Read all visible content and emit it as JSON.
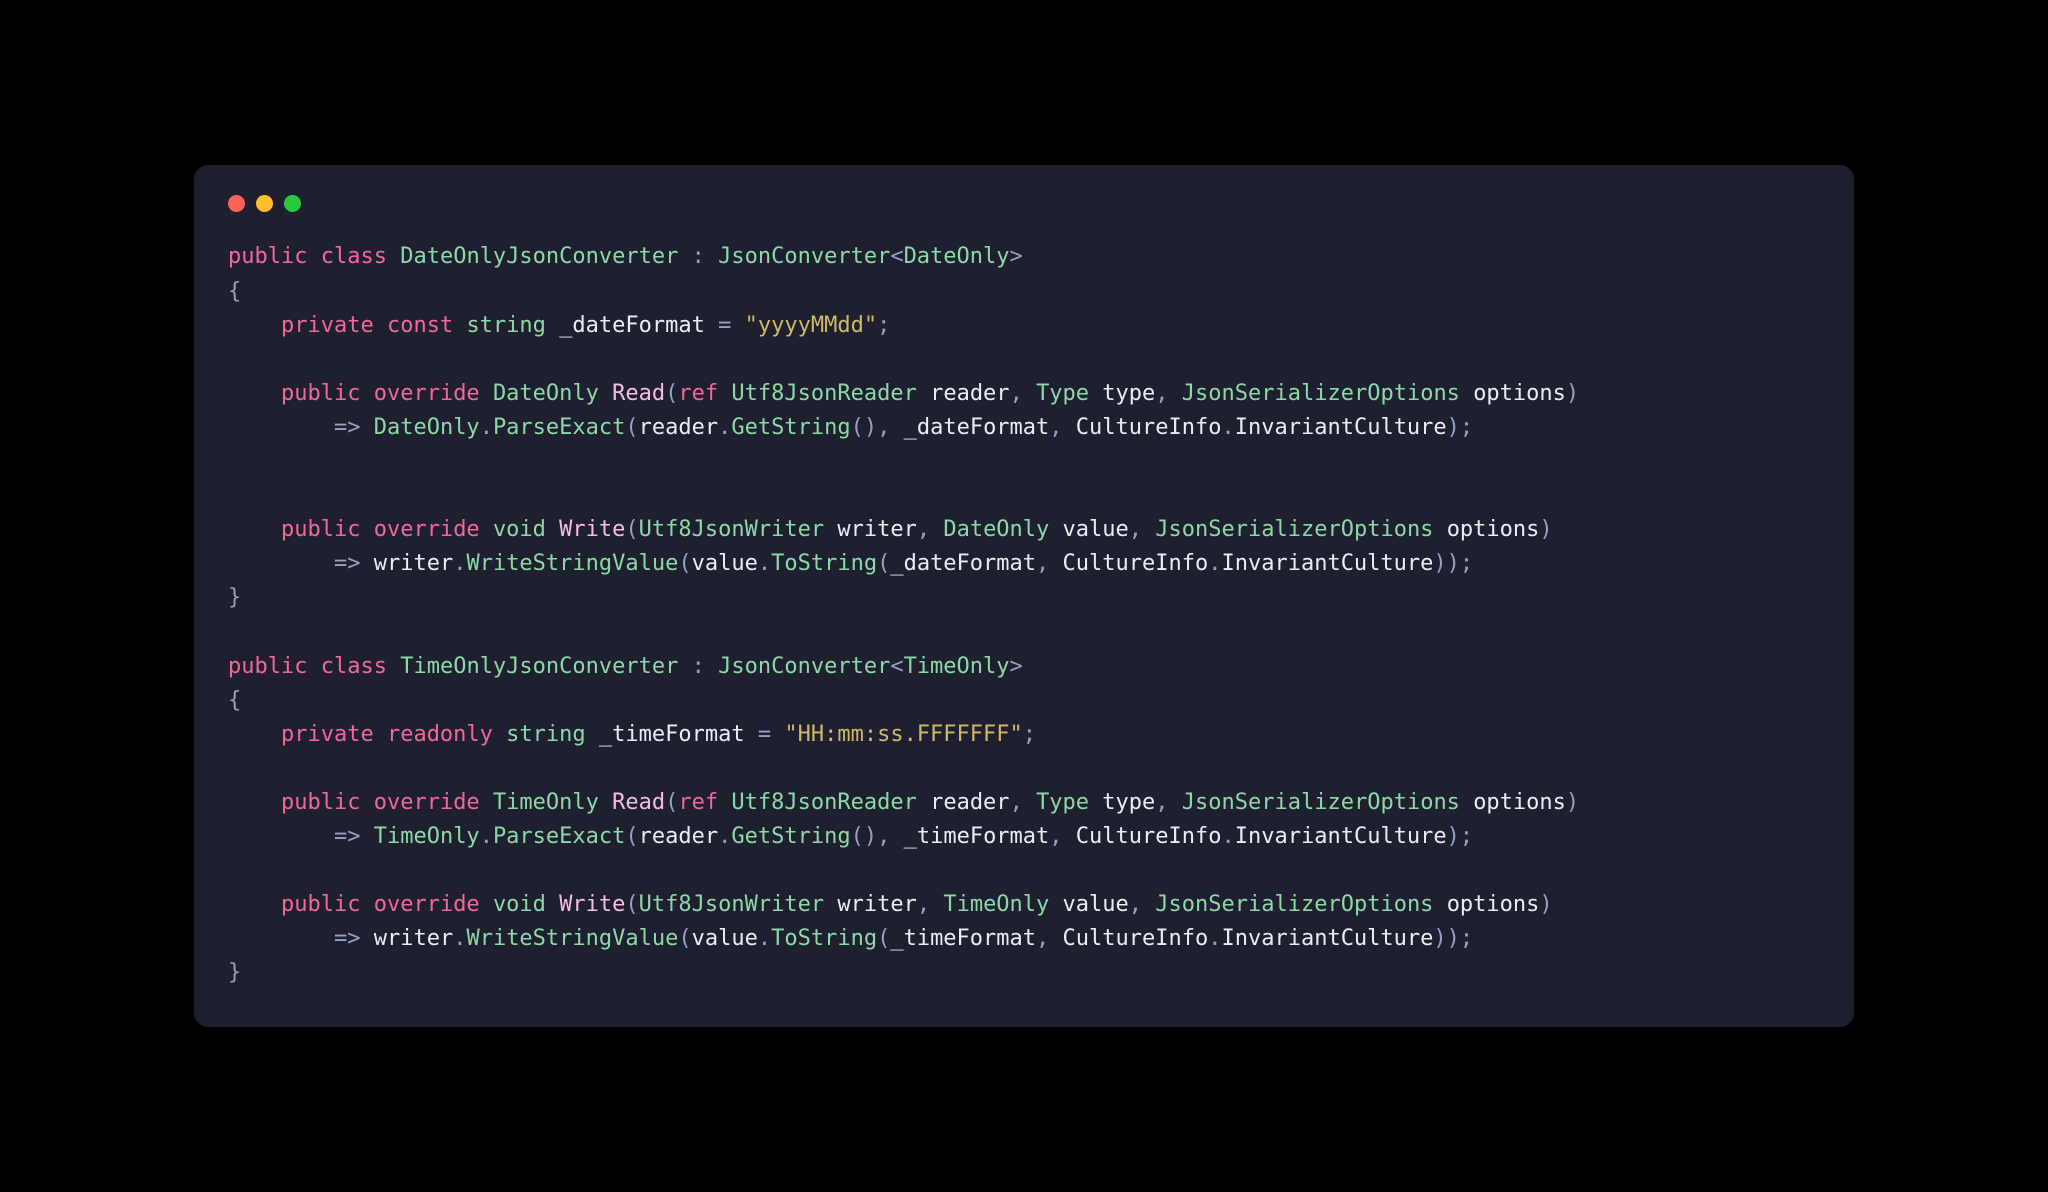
{
  "code": {
    "line1": {
      "kw_public": "public",
      "kw_class": "class",
      "ty_name": "DateOnlyJsonConverter",
      "colon": ":",
      "ty_base": "JsonConverter",
      "lt": "<",
      "ty_param": "DateOnly",
      "gt": ">"
    },
    "line2": {
      "brace": "{"
    },
    "line3": {
      "kw_private": "private",
      "kw_const": "const",
      "ty_string": "string",
      "id_field": "_dateFormat",
      "eq": "=",
      "str": "\"yyyyMMdd\"",
      "semi": ";"
    },
    "line4": "",
    "line5": {
      "kw_public": "public",
      "kw_override": "override",
      "ty_ret": "DateOnly",
      "fn_name": "Read",
      "lp": "(",
      "kw_ref": "ref",
      "ty_p1": "Utf8JsonReader",
      "id_p1": "reader",
      "c1": ",",
      "ty_p2": "Type",
      "id_p2": "type",
      "c2": ",",
      "ty_p3": "JsonSerializerOptions",
      "id_p3": "options",
      "rp": ")"
    },
    "line6": {
      "arrow": "=>",
      "ty": "DateOnly",
      "dot1": ".",
      "mth1": "ParseExact",
      "lp": "(",
      "id_r": "reader",
      "dot2": ".",
      "mth2": "GetString",
      "lp2": "(",
      "rp2": ")",
      "c1": ",",
      "id_fmt": "_dateFormat",
      "c2": ",",
      "id_ci": "CultureInfo",
      "dot3": ".",
      "id_ic": "InvariantCulture",
      "rp": ")",
      "semi": ";"
    },
    "line7": "",
    "line8": "",
    "line9": {
      "kw_public": "public",
      "kw_override": "override",
      "ty_ret": "void",
      "fn_name": "Write",
      "lp": "(",
      "ty_p1": "Utf8JsonWriter",
      "id_p1": "writer",
      "c1": ",",
      "ty_p2": "DateOnly",
      "id_p2": "value",
      "c2": ",",
      "ty_p3": "JsonSerializerOptions",
      "id_p3": "options",
      "rp": ")"
    },
    "line10": {
      "arrow": "=>",
      "id_w": "writer",
      "dot1": ".",
      "mth1": "WriteStringValue",
      "lp": "(",
      "id_v": "value",
      "dot2": ".",
      "mth2": "ToString",
      "lp2": "(",
      "id_fmt": "_dateFormat",
      "c1": ",",
      "id_ci": "CultureInfo",
      "dot3": ".",
      "id_ic": "InvariantCulture",
      "rp2": ")",
      "rp": ")",
      "semi": ";"
    },
    "line11": {
      "brace": "}"
    },
    "line12": "",
    "line13": {
      "kw_public": "public",
      "kw_class": "class",
      "ty_name": "TimeOnlyJsonConverter",
      "colon": ":",
      "ty_base": "JsonConverter",
      "lt": "<",
      "ty_param": "TimeOnly",
      "gt": ">"
    },
    "line14": {
      "brace": "{"
    },
    "line15": {
      "kw_private": "private",
      "kw_readonly": "readonly",
      "ty_string": "string",
      "id_field": "_timeFormat",
      "eq": "=",
      "str": "\"HH:mm:ss.FFFFFFF\"",
      "semi": ";"
    },
    "line16": "",
    "line17": {
      "kw_public": "public",
      "kw_override": "override",
      "ty_ret": "TimeOnly",
      "fn_name": "Read",
      "lp": "(",
      "kw_ref": "ref",
      "ty_p1": "Utf8JsonReader",
      "id_p1": "reader",
      "c1": ",",
      "ty_p2": "Type",
      "id_p2": "type",
      "c2": ",",
      "ty_p3": "JsonSerializerOptions",
      "id_p3": "options",
      "rp": ")"
    },
    "line18": {
      "arrow": "=>",
      "ty": "TimeOnly",
      "dot1": ".",
      "mth1": "ParseExact",
      "lp": "(",
      "id_r": "reader",
      "dot2": ".",
      "mth2": "GetString",
      "lp2": "(",
      "rp2": ")",
      "c1": ",",
      "id_fmt": "_timeFormat",
      "c2": ",",
      "id_ci": "CultureInfo",
      "dot3": ".",
      "id_ic": "InvariantCulture",
      "rp": ")",
      "semi": ";"
    },
    "line19": "",
    "line20": {
      "kw_public": "public",
      "kw_override": "override",
      "ty_ret": "void",
      "fn_name": "Write",
      "lp": "(",
      "ty_p1": "Utf8JsonWriter",
      "id_p1": "writer",
      "c1": ",",
      "ty_p2": "TimeOnly",
      "id_p2": "value",
      "c2": ",",
      "ty_p3": "JsonSerializerOptions",
      "id_p3": "options",
      "rp": ")"
    },
    "line21": {
      "arrow": "=>",
      "id_w": "writer",
      "dot1": ".",
      "mth1": "WriteStringValue",
      "lp": "(",
      "id_v": "value",
      "dot2": ".",
      "mth2": "ToString",
      "lp2": "(",
      "id_fmt": "_timeFormat",
      "c1": ",",
      "id_ci": "CultureInfo",
      "dot3": ".",
      "id_ic": "InvariantCulture",
      "rp2": ")",
      "rp": ")",
      "semi": ";"
    },
    "line22": {
      "brace": "}"
    }
  }
}
